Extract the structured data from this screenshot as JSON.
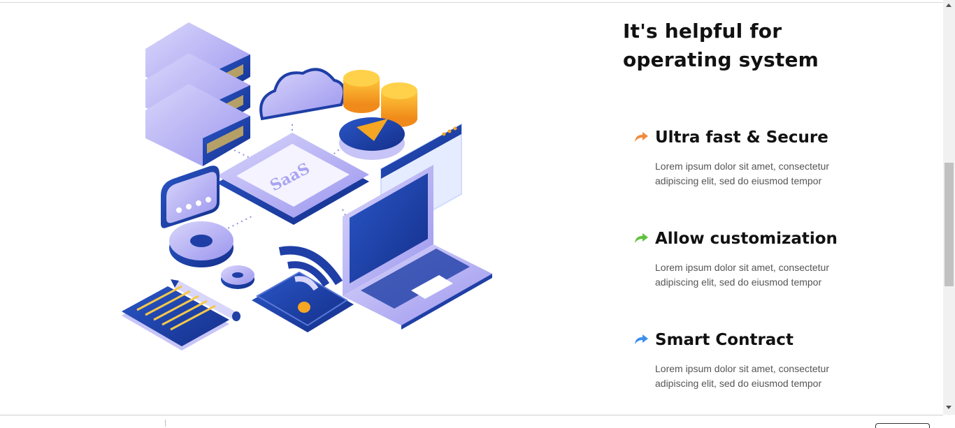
{
  "heading": {
    "line1": "It's helpful for",
    "line2": "operating system"
  },
  "illustration": {
    "saas_label": "SaaS"
  },
  "features": [
    {
      "title": "Ultra fast & Secure",
      "icon": "arrow-curved-right-icon",
      "icon_color": "#f08a3c",
      "desc_line1": "Lorem ipsum dolor sit amet, consectetur",
      "desc_line2": "adipiscing elit, sed do eiusmod tempor"
    },
    {
      "title": "Allow customization",
      "icon": "arrow-curved-right-icon",
      "icon_color": "#5fc23a",
      "desc_line1": "Lorem ipsum dolor sit amet, consectetur",
      "desc_line2": "adipiscing elit, sed do eiusmod tempor"
    },
    {
      "title": "Smart Contract",
      "icon": "arrow-curved-right-icon",
      "icon_color": "#3d8ef0",
      "desc_line1": "Lorem ipsum dolor sit amet, consectetur",
      "desc_line2": "adipiscing elit, sed do eiusmod tempor"
    }
  ],
  "colors": {
    "primary": "#1f3fa6",
    "lavender": "#a9a4f2",
    "accent": "#f5a623"
  }
}
